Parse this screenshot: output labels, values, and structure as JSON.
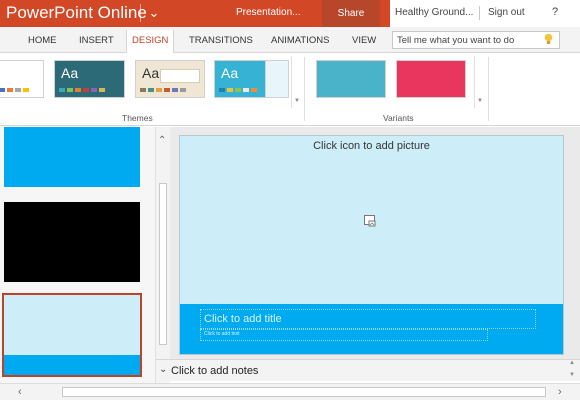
{
  "titlebar": {
    "app_title": "PowerPoint Online",
    "document_name": "Presentation...",
    "share_label": "Share",
    "user_name": "Healthy Ground...",
    "signout_label": "Sign out",
    "help_label": "?",
    "brand_color": "#d24726"
  },
  "ribbon_tabs": {
    "home": "HOME",
    "insert": "INSERT",
    "design": "DESIGN",
    "transitions": "TRANSITIONS",
    "animations": "ANIMATIONS",
    "view": "VIEW",
    "active": "DESIGN",
    "tell_me_placeholder": "Tell me what you want to do"
  },
  "ribbon": {
    "themes_label": "Themes",
    "variants_label": "Variants",
    "themes": [
      {
        "name": "theme-office",
        "preview_text": "",
        "background": "#ffffff"
      },
      {
        "name": "theme-dark-teal",
        "preview_text": "Aa",
        "background": "#2d6a78",
        "text_color": "#ffffff"
      },
      {
        "name": "theme-paper",
        "preview_text": "Aa",
        "background": "#efe6d6",
        "text_color": "#333333"
      },
      {
        "name": "theme-cyan",
        "preview_text": "Aa",
        "background": "#36b3d4",
        "text_color": "#ffffff"
      }
    ],
    "variants": [
      {
        "name": "variant-teal",
        "background": "#4bb3c9"
      },
      {
        "name": "variant-crimson",
        "background": "#e8365e"
      }
    ]
  },
  "slides_panel": {
    "slides": [
      {
        "name": "slide-thumbnail-1",
        "background": "#00aaf0",
        "selected": false
      },
      {
        "name": "slide-thumbnail-2",
        "background": "#000000",
        "selected": false
      },
      {
        "name": "slide-thumbnail-3",
        "background": "#cdeef9",
        "band": "#00aaf0",
        "selected": true
      }
    ]
  },
  "slide": {
    "picture_placeholder": "Click icon to add picture",
    "title_placeholder": "Click to add title",
    "subtitle_placeholder": "Click to add text",
    "background": "#cdeef9",
    "band_color": "#00aaf0"
  },
  "notes": {
    "label": "Click to add notes"
  }
}
